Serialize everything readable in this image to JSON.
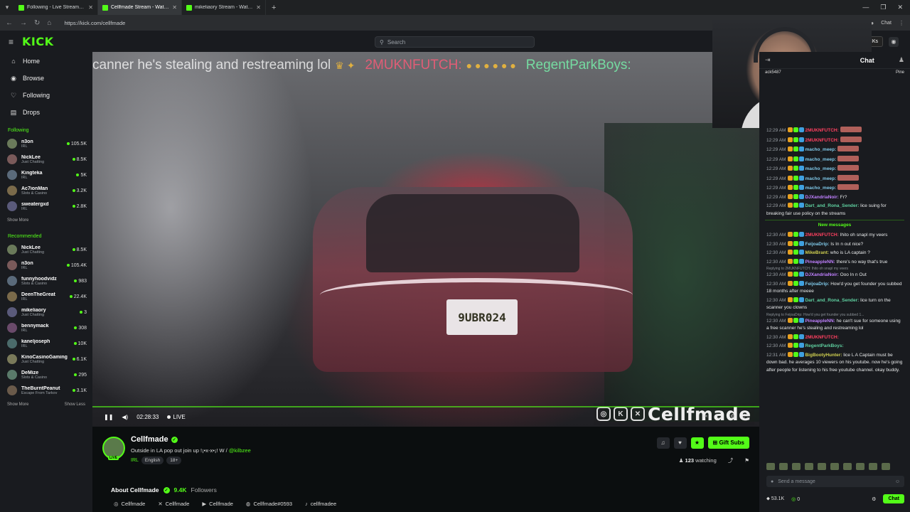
{
  "browser": {
    "tabs": [
      {
        "title": "Following - Live Streams on Kick",
        "active": false
      },
      {
        "title": "Cellfmade Stream - Watch Live on Kick",
        "active": true
      },
      {
        "title": "mikeliaory Stream - Watch Live on Kick",
        "active": false
      }
    ],
    "url": "https://kick.com/cellfmade",
    "chat_pill": "Chat"
  },
  "header": {
    "logo": "KICK",
    "search_placeholder": "Search",
    "get_kicks": "Get KICKs"
  },
  "sidebar": {
    "nav": [
      {
        "label": "Home",
        "icon": "home-icon",
        "glyph": "⌂"
      },
      {
        "label": "Browse",
        "icon": "browse-icon",
        "glyph": "◉"
      },
      {
        "label": "Following",
        "icon": "heart-icon",
        "glyph": "♡"
      },
      {
        "label": "Drops",
        "icon": "drops-icon",
        "glyph": "▤"
      }
    ],
    "following_title": "Following",
    "following": [
      {
        "name": "n3on",
        "category": "IRL",
        "viewers": "105.5K"
      },
      {
        "name": "NickLee",
        "category": "Just Chatting",
        "viewers": "8.5K"
      },
      {
        "name": "Kingteka",
        "category": "IRL",
        "viewers": "5K"
      },
      {
        "name": "Ac7ionMan",
        "category": "Slots & Casino",
        "viewers": "3.2K"
      },
      {
        "name": "sweatergxd",
        "category": "IRL",
        "viewers": "2.8K"
      }
    ],
    "show_more": "Show More",
    "show_less": "Show Less",
    "recommended_title": "Recommended",
    "recommended": [
      {
        "name": "NickLee",
        "category": "Just Chatting",
        "viewers": "8.5K"
      },
      {
        "name": "n3on",
        "category": "IRL",
        "viewers": "105.4K"
      },
      {
        "name": "funnyhoodvidz",
        "category": "Slots & Casino",
        "viewers": "983"
      },
      {
        "name": "DeenTheGreat",
        "category": "IRL",
        "viewers": "22.4K"
      },
      {
        "name": "mikeliaory",
        "category": "Just Chatting",
        "viewers": "3"
      },
      {
        "name": "bennymack",
        "category": "IRL",
        "viewers": "308"
      },
      {
        "name": "kaneljoseph",
        "category": "IRL",
        "viewers": "10K"
      },
      {
        "name": "KinoCasinoGaming",
        "category": "Just Chatting",
        "viewers": "6.1K"
      },
      {
        "name": "DeMize",
        "category": "Slots & Casino",
        "viewers": "295"
      },
      {
        "name": "TheBurntPeanut",
        "category": "Escape From Tarkov",
        "viewers": "3.1K"
      }
    ]
  },
  "video": {
    "ticker_1": "canner he's stealing and restreaming lol",
    "ticker_2": "2MUKNFUTCH:",
    "ticker_3": "RegentParkBoys:",
    "plate": "9UBR024",
    "watermark": "Cellfmade",
    "elapsed": "02:28:33",
    "live_label": "LIVE"
  },
  "channel": {
    "name": "Cellfmade",
    "title_text": "Outside in LA pop out join up !¡•x-x•¡! W / ",
    "title_mention": "@kilbzee",
    "category": "IRL",
    "tags": [
      "English",
      "18+"
    ],
    "gift_subs": "Gift Subs",
    "watching": "123",
    "watching_label": "watching",
    "about_label": "About Cellfmade",
    "followers": "9.4K",
    "followers_label": "Followers",
    "socials": [
      {
        "icon": "instagram-icon",
        "glyph": "◎",
        "label": "Cellfmade"
      },
      {
        "icon": "x-icon",
        "glyph": "✕",
        "label": "Cellfmade"
      },
      {
        "icon": "youtube-icon",
        "glyph": "▶",
        "label": "Cellfmade"
      },
      {
        "icon": "discord-icon",
        "glyph": "◍",
        "label": "Cellfmade#0593"
      },
      {
        "icon": "tiktok-icon",
        "glyph": "♪",
        "label": "cellfmadee"
      }
    ]
  },
  "chat": {
    "title": "Chat",
    "pinned_left": "ack5487",
    "pinned_right": "Pine",
    "messages": [
      {
        "time": "12:29 AM",
        "user": "2MUKNFUTCH:",
        "color": "#ff4060",
        "text": "",
        "emotes": true
      },
      {
        "time": "12:29 AM",
        "user": "2MUKNFUTCH:",
        "color": "#ff4060",
        "text": "",
        "emotes": true
      },
      {
        "time": "12:29 AM",
        "user": "macho_meep:",
        "color": "#7fc8e8",
        "text": "",
        "emotes": true
      },
      {
        "time": "12:29 AM",
        "user": "macho_meep:",
        "color": "#7fc8e8",
        "text": "",
        "emotes": true
      },
      {
        "time": "12:29 AM",
        "user": "macho_meep:",
        "color": "#7fc8e8",
        "text": "",
        "emotes": true
      },
      {
        "time": "12:29 AM",
        "user": "macho_meep:",
        "color": "#7fc8e8",
        "text": "",
        "emotes": true
      },
      {
        "time": "12:29 AM",
        "user": "macho_meep:",
        "color": "#7fc8e8",
        "text": "",
        "emotes": true
      },
      {
        "time": "12:29 AM",
        "user": "DJXandriaNoir:",
        "color": "#c080ff",
        "text": "Fr?",
        "emotes": false
      },
      {
        "time": "12:29 AM",
        "user": "Dart_and_Rona_Sender:",
        "color": "#5fd0a0",
        "text": "lice suing for breaking fair use policy on the streams",
        "emotes": false
      }
    ],
    "new_messages_label": "New messages",
    "messages2": [
      {
        "time": "12:30 AM",
        "user": "2MUKNFUTCH:",
        "color": "#ff4060",
        "text": "Ihito oh snapl my veers",
        "reply": ""
      },
      {
        "time": "12:30 AM",
        "user": "FeijoaDrip:",
        "color": "#7fc8e8",
        "text": "Is In n out nice?",
        "reply": ""
      },
      {
        "time": "12:30 AM",
        "user": "MikeBrant:",
        "color": "#d0d050",
        "text": "who is LA captain ?",
        "reply": ""
      },
      {
        "time": "12:30 AM",
        "user": "PineappleNN:",
        "color": "#c080ff",
        "text": "there's no way that's true",
        "reply": ""
      },
      {
        "time": "12:30 AM",
        "user": "DJXandriaNoir:",
        "color": "#c080ff",
        "text": "Ooo In n Out",
        "reply": "Replying to 2MUKNFUTCH: Ihito oh snapl my veers"
      },
      {
        "time": "12:30 AM",
        "user": "FeijoaDrip:",
        "color": "#7fc8e8",
        "text": "How'd you get founder you subbed 18 months after meeee",
        "reply": ""
      },
      {
        "time": "12:30 AM",
        "user": "Dart_and_Rona_Sender:",
        "color": "#5fd0a0",
        "text": "lice turn on the scanner you clowns",
        "reply": ""
      },
      {
        "time": "12:30 AM",
        "user": "PineappleNN:",
        "color": "#c080ff",
        "text": "he can't sue for someone using a free scanner he's stealing and restreaming lol",
        "reply": "Replying to FeijoaDrip: How'd you get founder you subbed 1..."
      },
      {
        "time": "12:30 AM",
        "user": "2MUKNFUTCH:",
        "color": "#ff4060",
        "text": "",
        "reply": ""
      },
      {
        "time": "12:30 AM",
        "user": "RegentParkBoys:",
        "color": "#5fd0a0",
        "text": "",
        "reply": ""
      },
      {
        "time": "12:31 AM",
        "user": "BigBootyHunter:",
        "color": "#d0d050",
        "text": "lice L A Captain must be down bad. he averages 10 viewers on his youtube. now he's going after people for listening to his free youtube channel. okay buddy.",
        "reply": ""
      }
    ],
    "input_placeholder": "Send a message",
    "kicks_count": "53.1K",
    "points": "0",
    "send_label": "Chat"
  }
}
